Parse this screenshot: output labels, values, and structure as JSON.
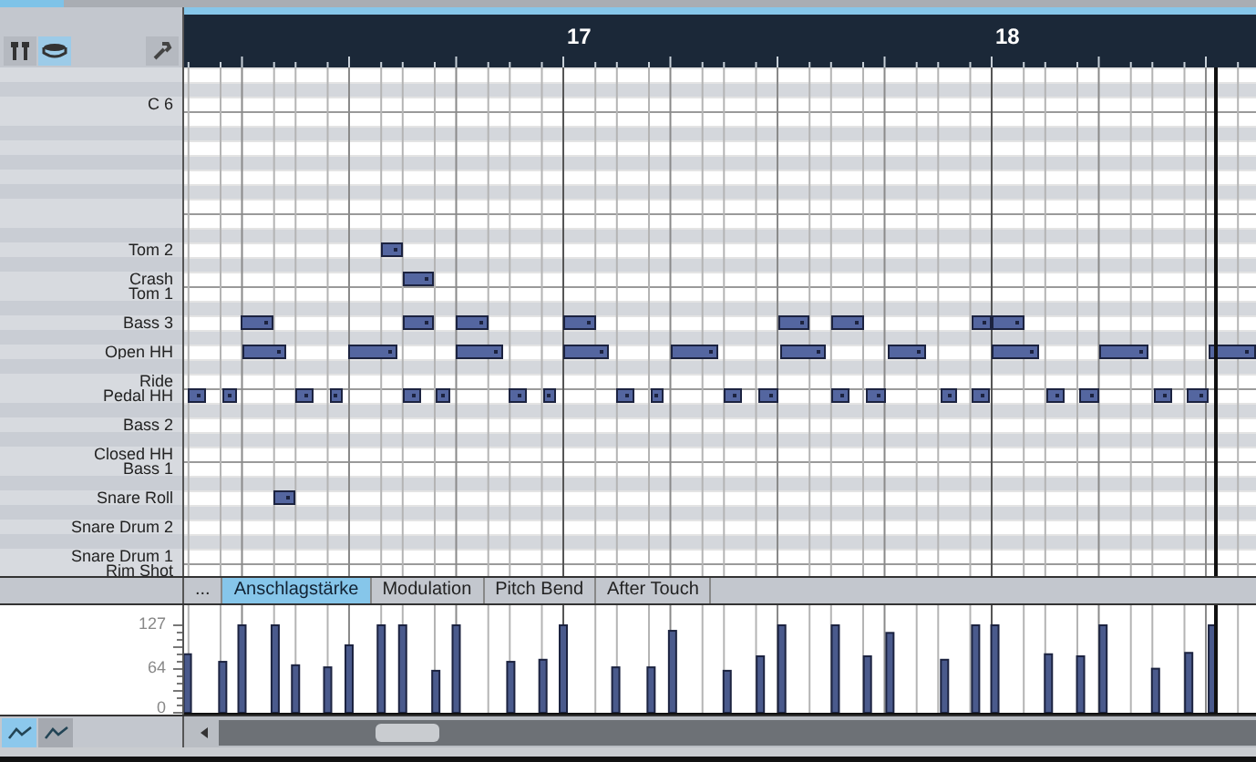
{
  "view_buttons": [
    {
      "kind": "sticks",
      "selected": false
    },
    {
      "kind": "drum",
      "selected": true
    }
  ],
  "ruler": {
    "bars": [
      "17",
      "18"
    ]
  },
  "key_labels": [
    "C 6",
    "Tom 2",
    "Crash",
    "Tom 1",
    "Bass 3",
    "Open HH",
    "Ride",
    "Pedal HH",
    "Bass 2",
    "Closed HH",
    "Bass 1",
    "Snare Roll",
    "Snare Drum 2",
    "Snare Drum 1",
    "Rim Shot"
  ],
  "controller_tabs": [
    {
      "label": "...",
      "selected": false
    },
    {
      "label": "Anschlagstärke",
      "selected": true
    },
    {
      "label": "Modulation",
      "selected": false
    },
    {
      "label": "Pitch Bend",
      "selected": false
    },
    {
      "label": "After Touch",
      "selected": false
    }
  ],
  "velocity_lane": {
    "scale_labels": [
      "127",
      "64",
      "0"
    ]
  },
  "lane_buttons": [
    {
      "kind": "line",
      "selected": true
    },
    {
      "kind": "line",
      "selected": false
    }
  ]
}
